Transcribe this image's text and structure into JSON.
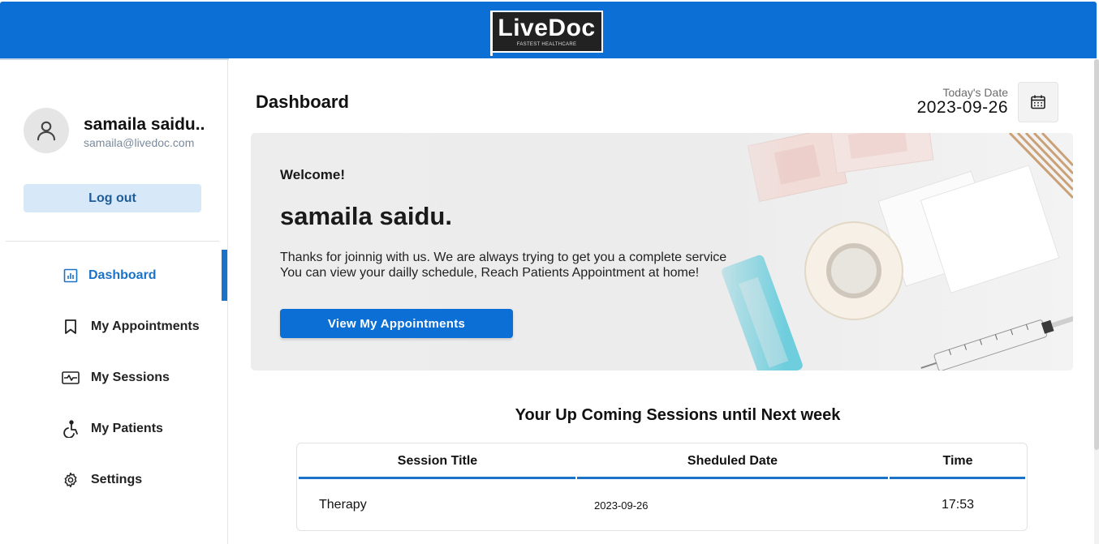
{
  "header": {
    "logo_text": "LiveDoc",
    "logo_tagline": "FASTEST HEALTHCARE"
  },
  "sidebar": {
    "user_name": "samaila saidu..",
    "user_email": "samaila@livedoc.com",
    "logout_label": "Log out",
    "items": [
      {
        "label": "Dashboard",
        "icon": "dashboard-icon",
        "active": true
      },
      {
        "label": "My Appointments",
        "icon": "bookmark-icon",
        "active": false
      },
      {
        "label": "My Sessions",
        "icon": "sessions-icon",
        "active": false
      },
      {
        "label": "My Patients",
        "icon": "accessibility-icon",
        "active": false
      },
      {
        "label": "Settings",
        "icon": "gear-icon",
        "active": false
      }
    ]
  },
  "main": {
    "title": "Dashboard",
    "date_label": "Today's Date",
    "date_value": "2023-09-26",
    "hero": {
      "welcome": "Welcome!",
      "name": "samaila saidu.",
      "line1": "Thanks for joinnig with us. We are always trying to get you a complete service",
      "line2": "You can view your dailly schedule, Reach Patients Appointment at home!",
      "button_label": "View My Appointments"
    },
    "sessions": {
      "title": "Your Up Coming Sessions until Next week",
      "columns": [
        "Session Title",
        "Sheduled Date",
        "Time"
      ],
      "rows": [
        [
          "Therapy",
          "2023-09-26",
          "17:53"
        ]
      ]
    }
  },
  "colors": {
    "brand_blue": "#0b6fd6",
    "active_blue": "#1b72c9",
    "logout_bg": "#d7e8f8"
  }
}
